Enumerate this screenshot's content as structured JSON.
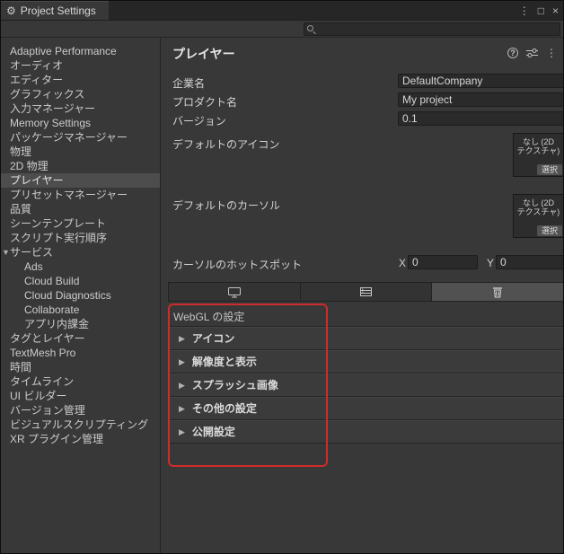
{
  "window": {
    "title": "Project Settings"
  },
  "toolbar": {
    "search_value": ""
  },
  "sidebar": {
    "items": [
      {
        "label": "Adaptive Performance"
      },
      {
        "label": "オーディオ"
      },
      {
        "label": "エディター"
      },
      {
        "label": "グラフィックス"
      },
      {
        "label": "入力マネージャー"
      },
      {
        "label": "Memory Settings"
      },
      {
        "label": "パッケージマネージャー"
      },
      {
        "label": "物理"
      },
      {
        "label": "2D 物理"
      },
      {
        "label": "プレイヤー",
        "selected": true
      },
      {
        "label": "プリセットマネージャー"
      },
      {
        "label": "品質"
      },
      {
        "label": "シーンテンプレート"
      },
      {
        "label": "スクリプト実行順序"
      },
      {
        "label": "サービス",
        "expanded": true
      },
      {
        "label": "Ads",
        "child": true
      },
      {
        "label": "Cloud Build",
        "child": true
      },
      {
        "label": "Cloud Diagnostics",
        "child": true
      },
      {
        "label": "Collaborate",
        "child": true
      },
      {
        "label": "アプリ内課金",
        "child": true
      },
      {
        "label": "タグとレイヤー"
      },
      {
        "label": "TextMesh Pro"
      },
      {
        "label": "時間"
      },
      {
        "label": "タイムライン"
      },
      {
        "label": "UI ビルダー"
      },
      {
        "label": "バージョン管理"
      },
      {
        "label": "ビジュアルスクリプティング"
      },
      {
        "label": "XR プラグイン管理"
      }
    ]
  },
  "player": {
    "title": "プレイヤー",
    "company": {
      "label": "企業名",
      "value": "DefaultCompany"
    },
    "product": {
      "label": "プロダクト名",
      "value": "My project"
    },
    "version": {
      "label": "バージョン",
      "value": "0.1"
    },
    "default_icon": {
      "label": "デフォルトのアイコン",
      "thumb_line1": "なし (2D",
      "thumb_line2": "テクスチャ)",
      "select_label": "選択"
    },
    "default_cursor": {
      "label": "デフォルトのカーソル",
      "thumb_line1": "なし (2D",
      "thumb_line2": "テクスチャ)",
      "select_label": "選択"
    },
    "hotspot": {
      "label": "カーソルのホットスポット",
      "x_label": "X",
      "x_value": "0",
      "y_label": "Y",
      "y_value": "0"
    },
    "platform_tabs": [
      {
        "name": "standalone",
        "selected": false
      },
      {
        "name": "dedicated-server",
        "selected": false
      },
      {
        "name": "webgl",
        "selected": true
      }
    ],
    "webgl_section": {
      "header": "WebGL の設定",
      "foldouts": [
        "アイコン",
        "解像度と表示",
        "スプラッシュ画像",
        "その他の設定",
        "公開設定"
      ]
    }
  },
  "colors": {
    "annotation_red": "#cf2b2b",
    "selection_gray": "#4d4d4d",
    "panel_bg": "#383838",
    "field_bg": "#2a2a2a"
  }
}
